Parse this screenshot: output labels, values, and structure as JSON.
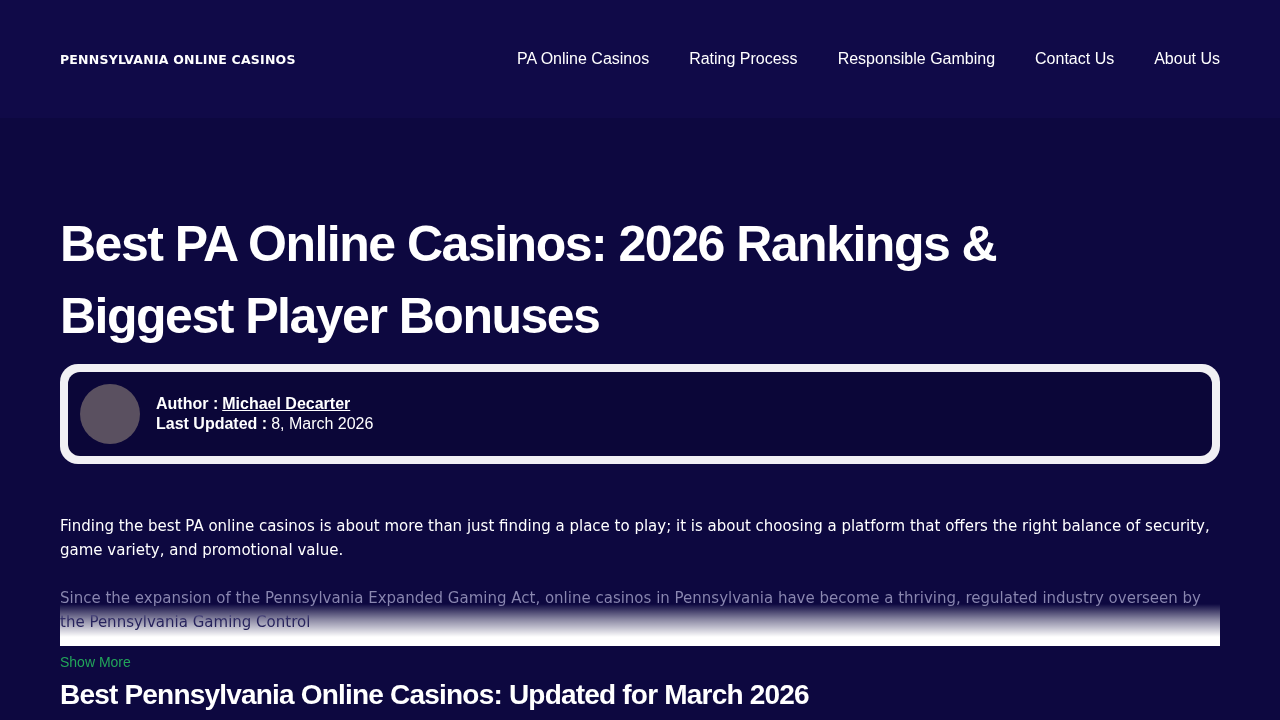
{
  "header": {
    "logo": "PENNSYLVANIA ONLINE CASINOS",
    "nav": [
      {
        "label": "PA Online Casinos"
      },
      {
        "label": "Rating Process"
      },
      {
        "label": "Responsible Gambing"
      },
      {
        "label": "Contact Us"
      },
      {
        "label": "About Us"
      }
    ]
  },
  "title": "Best PA Online Casinos: 2026 Rankings & Biggest Player Bonuses",
  "author_box": {
    "author_label": "Author :",
    "author_name": "Michael Decarter",
    "updated_label": "Last Updated :",
    "updated_date": "8, March 2026"
  },
  "intro": "Finding the best PA online casinos is about more than just finding a place to play; it is about choosing a platform that offers the right balance of security, game variety, and promotional value.",
  "faded_paragraph": "Since the expansion of the Pennsylvania Expanded Gaming Act, online casinos in Pennsylvania have become a thriving, regulated industry overseen by the Pennsylvania Gaming Control",
  "show_more": "Show More",
  "section_heading": "Best Pennsylvania Online Casinos: Updated for March 2026"
}
